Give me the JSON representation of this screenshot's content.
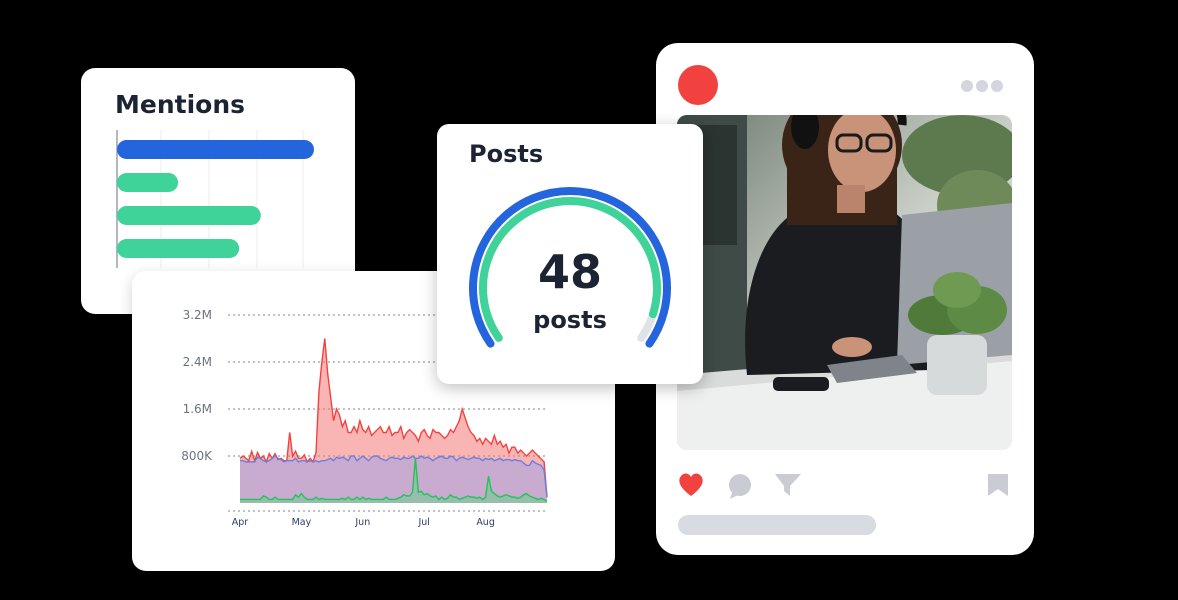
{
  "mentions": {
    "title": "Mentions",
    "bars": [
      {
        "value": 1.0,
        "color": "#2464dc"
      },
      {
        "value": 0.31,
        "color": "#3fd39a"
      },
      {
        "value": 0.73,
        "color": "#3fd39a"
      },
      {
        "value": 0.62,
        "color": "#3fd39a"
      }
    ]
  },
  "posts": {
    "title": "Posts",
    "count": "48",
    "unit": "posts",
    "outer_fraction": 1.0,
    "inner_fraction": 0.93
  },
  "social_post": {
    "icons": [
      "heart-icon",
      "comment-icon",
      "send-icon",
      "bookmark-icon"
    ]
  },
  "colors": {
    "blue": "#2464dc",
    "green": "#3fd39a",
    "red": "#f2423f",
    "text": "#1c2433"
  },
  "chart_data": {
    "type": "area",
    "title": "",
    "xlabel": "",
    "ylabel": "",
    "ylim": [
      0,
      3200000
    ],
    "yticks": [
      "3.2M",
      "2.4M",
      "1.6M",
      "800K"
    ],
    "ytick_values": [
      3200000,
      2400000,
      1600000,
      800000
    ],
    "xticks": [
      "Apr",
      "May",
      "Jun",
      "Jul",
      "Aug"
    ],
    "xtick_positions": [
      0,
      21,
      42,
      63,
      84
    ],
    "x_count": 106,
    "grid": true,
    "series": [
      {
        "color": "#f2423f",
        "values": [
          760000,
          800000,
          760000,
          720000,
          880000,
          720000,
          860000,
          760000,
          800000,
          700000,
          840000,
          760000,
          840000,
          740000,
          760000,
          720000,
          720000,
          1200000,
          800000,
          880000,
          760000,
          760000,
          820000,
          700000,
          760000,
          700000,
          860000,
          1900000,
          2400000,
          2800000,
          2200000,
          1800000,
          1400000,
          1600000,
          1500000,
          1300000,
          1400000,
          1200000,
          1200000,
          1300000,
          1200000,
          1400000,
          1250000,
          1200000,
          1300000,
          1150000,
          1200000,
          1250000,
          1300000,
          1200000,
          1200000,
          1300000,
          1150000,
          1200000,
          1200000,
          1300000,
          1100000,
          1200000,
          1250000,
          1200000,
          1150000,
          1050000,
          1200000,
          1250000,
          1150000,
          1100000,
          1250000,
          1200000,
          1200000,
          1150000,
          1100000,
          1150000,
          1250000,
          1200000,
          1300000,
          1400000,
          1600000,
          1450000,
          1300000,
          1200000,
          1150000,
          1050000,
          1100000,
          1000000,
          1100000,
          1050000,
          1000000,
          1150000,
          1000000,
          1050000,
          950000,
          1000000,
          850000,
          950000,
          950000,
          850000,
          900000,
          850000,
          800000,
          850000,
          900000,
          850000,
          800000,
          750000,
          700000,
          100000
        ]
      },
      {
        "color": "#6a7fe0",
        "values": [
          720000,
          720000,
          700000,
          700000,
          700000,
          700000,
          780000,
          760000,
          720000,
          700000,
          720000,
          760000,
          800000,
          760000,
          740000,
          700000,
          720000,
          720000,
          720000,
          760000,
          700000,
          720000,
          720000,
          700000,
          720000,
          700000,
          720000,
          700000,
          720000,
          720000,
          740000,
          760000,
          720000,
          780000,
          760000,
          780000,
          760000,
          720000,
          800000,
          800000,
          720000,
          760000,
          800000,
          760000,
          720000,
          780000,
          800000,
          800000,
          760000,
          740000,
          720000,
          760000,
          780000,
          760000,
          760000,
          740000,
          780000,
          760000,
          760000,
          800000,
          760000,
          760000,
          800000,
          760000,
          780000,
          760000,
          720000,
          760000,
          780000,
          800000,
          760000,
          760000,
          800000,
          780000,
          720000,
          760000,
          780000,
          760000,
          740000,
          760000,
          780000,
          760000,
          760000,
          720000,
          760000,
          740000,
          760000,
          720000,
          740000,
          760000,
          720000,
          740000,
          740000,
          720000,
          740000,
          720000,
          720000,
          680000,
          640000,
          640000,
          720000,
          680000,
          660000,
          640000,
          560000,
          100000
        ]
      },
      {
        "color": "#22c35a",
        "values": [
          60000,
          60000,
          60000,
          60000,
          60000,
          60000,
          60000,
          60000,
          120000,
          100000,
          60000,
          60000,
          100000,
          60000,
          60000,
          60000,
          60000,
          60000,
          60000,
          140000,
          100000,
          160000,
          100000,
          60000,
          60000,
          60000,
          100000,
          60000,
          80000,
          60000,
          60000,
          60000,
          60000,
          60000,
          60000,
          80000,
          60000,
          100000,
          60000,
          60000,
          100000,
          60000,
          100000,
          60000,
          80000,
          60000,
          60000,
          60000,
          60000,
          60000,
          100000,
          60000,
          60000,
          60000,
          80000,
          100000,
          140000,
          120000,
          120000,
          180000,
          760000,
          180000,
          200000,
          140000,
          160000,
          120000,
          100000,
          120000,
          60000,
          100000,
          60000,
          80000,
          140000,
          100000,
          100000,
          60000,
          80000,
          100000,
          120000,
          100000,
          100000,
          80000,
          100000,
          60000,
          100000,
          460000,
          200000,
          160000,
          120000,
          100000,
          120000,
          140000,
          120000,
          100000,
          100000,
          80000,
          100000,
          140000,
          160000,
          120000,
          100000,
          80000,
          60000,
          80000,
          60000,
          30000
        ]
      }
    ]
  }
}
